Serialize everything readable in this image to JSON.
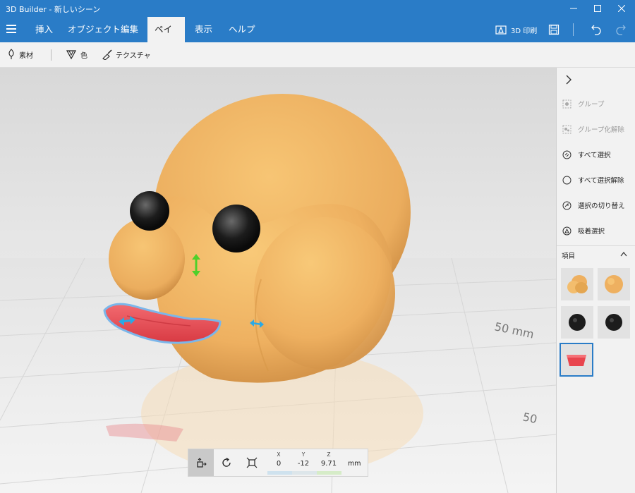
{
  "window": {
    "title": "3D Builder - 新しいシーン"
  },
  "menu": {
    "tabs": [
      {
        "label": "挿入"
      },
      {
        "label": "オブジェクト"
      },
      {
        "label": "編集"
      },
      {
        "label": "ペイント"
      },
      {
        "label": "表示"
      },
      {
        "label": "ヘルプ"
      }
    ],
    "active_tab": "ペイント",
    "print_label": "3D 印刷"
  },
  "toolbar": {
    "material_label": "素材",
    "color_label": "色",
    "texture_label": "テクスチャ"
  },
  "viewport": {
    "axis_label": "50 mm",
    "grid_label_2": "50"
  },
  "sidepanel": {
    "group_label": "グループ",
    "ungroup_label": "グループ化解除",
    "select_all_label": "すべて選択",
    "deselect_all_label": "すべて選択解除",
    "toggle_selection_label": "選択の切り替え",
    "lasso_label": "吸着選択",
    "items_header": "項目",
    "thumbnails": [
      "orange-blob",
      "orange-sphere",
      "black-sphere",
      "black-sphere",
      "red-beak"
    ]
  },
  "transform": {
    "x_label": "X",
    "x_value": "0",
    "y_label": "Y",
    "y_value": "-12",
    "z_label": "Z",
    "z_value": "9.71",
    "unit": "mm"
  },
  "colors": {
    "accent": "#2a7cc7",
    "body": "#f0b566",
    "beak": "#e8454e",
    "selected": "#2a7cc7"
  }
}
